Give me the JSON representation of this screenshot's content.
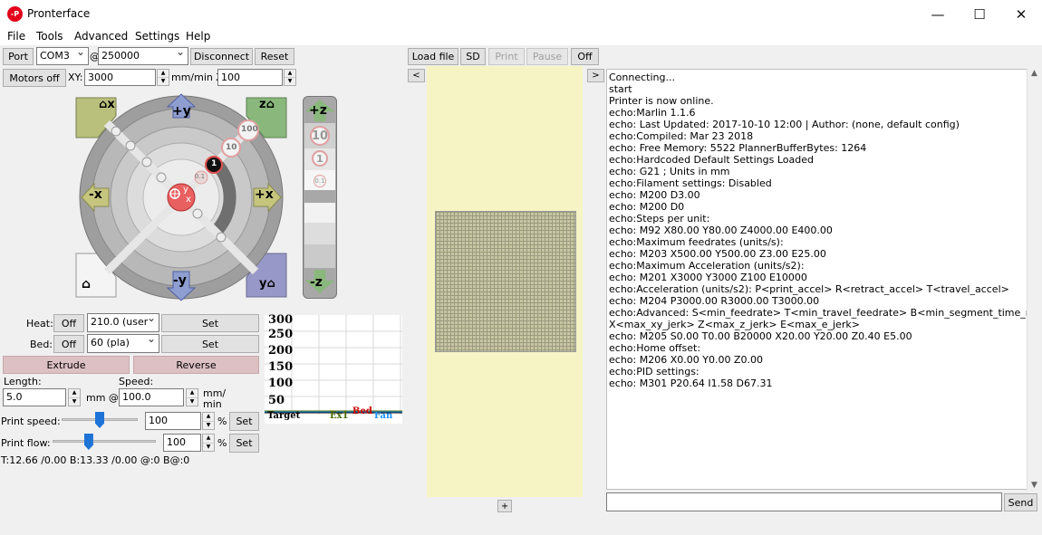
{
  "window": {
    "title": "Pronterface",
    "icon_text": "-P"
  },
  "window_controls": {
    "minimize": "—",
    "maximize": "☐",
    "close": "✕"
  },
  "menu": [
    "File",
    "Tools",
    "Advanced",
    "Settings",
    "Help"
  ],
  "connection": {
    "port_label": "Port",
    "port_value": "COM3",
    "at": "@",
    "baud_value": "250000",
    "disconnect_label": "Disconnect",
    "reset_label": "Reset"
  },
  "motion": {
    "motors_off_label": "Motors off",
    "xy_label": "XY:",
    "xy_value": "3000",
    "z_label": "mm/min Z:",
    "z_value": "100"
  },
  "jog": {
    "home_x": "x",
    "home_z": "z",
    "home_y": "y",
    "plus_y": "+y",
    "minus_y": "-y",
    "plus_x": "+x",
    "minus_x": "-x",
    "steps": [
      "100",
      "10",
      "1",
      "0.1"
    ],
    "center_y": "y",
    "center_x": "x",
    "plus_z": "+z",
    "minus_z": "-z",
    "z_steps": [
      "10",
      "1",
      "0.1"
    ]
  },
  "file_toolbar": {
    "load_label": "Load file",
    "sd_label": "SD",
    "print_label": "Print",
    "pause_label": "Pause",
    "off_label": "Off"
  },
  "plate_nav": {
    "left": "<",
    "right": ">",
    "add": "+"
  },
  "temps": {
    "heat_label": "Heat:",
    "heat_off": "Off",
    "heat_value": "210.0 (user",
    "heat_set": "Set",
    "bed_label": "Bed:",
    "bed_off": "Off",
    "bed_value": "60 (pla)",
    "bed_set": "Set"
  },
  "extrude": {
    "extrude_label": "Extrude",
    "reverse_label": "Reverse",
    "length_label": "Length:",
    "length_value": "5.0",
    "length_unit": "mm @",
    "speed_label": "Speed:",
    "speed_value": "100.0",
    "speed_unit_1": "mm/",
    "speed_unit_2": "min"
  },
  "print_speed": {
    "label": "Print speed:",
    "value": "100",
    "unit": "%",
    "set": "Set",
    "level": 0.5
  },
  "print_flow": {
    "label": "Print flow:",
    "value": "100",
    "unit": "%",
    "set": "Set",
    "level": 0.35
  },
  "status_line": "T:12.66 /0.00 B:13.33 /0.00 @:0 B@:0",
  "graph": {
    "y_ticks": [
      "300",
      "250",
      "200",
      "150",
      "100",
      "50"
    ],
    "legend": [
      "Target",
      "Ex1",
      "Bed",
      "Fan"
    ],
    "legend_colors": [
      "#000000",
      "#4a6b00",
      "#cc0000",
      "#1e90ff"
    ]
  },
  "console": {
    "send_label": "Send",
    "lines": [
      "Connecting...",
      "start",
      "Printer is now online.",
      "echo:Marlin 1.1.6",
      "echo: Last Updated: 2017-10-10 12:00 | Author: (none, default config)",
      "echo:Compiled: Mar 23 2018",
      "echo: Free Memory: 5522  PlannerBufferBytes: 1264",
      "echo:Hardcoded Default Settings Loaded",
      "echo:  G21    ; Units in mm",
      "echo:Filament settings: Disabled",
      "echo:  M200 D3.00",
      "echo:  M200 D0",
      "echo:Steps per unit:",
      "echo:  M92 X80.00 Y80.00 Z4000.00 E400.00",
      "echo:Maximum feedrates (units/s):",
      "echo:  M203 X500.00 Y500.00 Z3.00 E25.00",
      "echo:Maximum Acceleration (units/s2):",
      "echo:  M201 X3000 Y3000 Z100 E10000",
      "echo:Acceleration (units/s2): P<print_accel> R<retract_accel> T<travel_accel>",
      "echo:  M204 P3000.00 R3000.00 T3000.00",
      "echo:Advanced: S<min_feedrate> T<min_travel_feedrate> B<min_segment_time_ms>",
      "X<max_xy_jerk> Z<max_z_jerk> E<max_e_jerk>",
      "echo:  M205 S0.00 T0.00 B20000 X20.00 Y20.00 Z0.40 E5.00",
      "echo:Home offset:",
      "echo:  M206 X0.00 Y0.00 Z0.00",
      "echo:PID settings:",
      "echo:  M301 P20.64 I1.58 D67.31"
    ]
  }
}
